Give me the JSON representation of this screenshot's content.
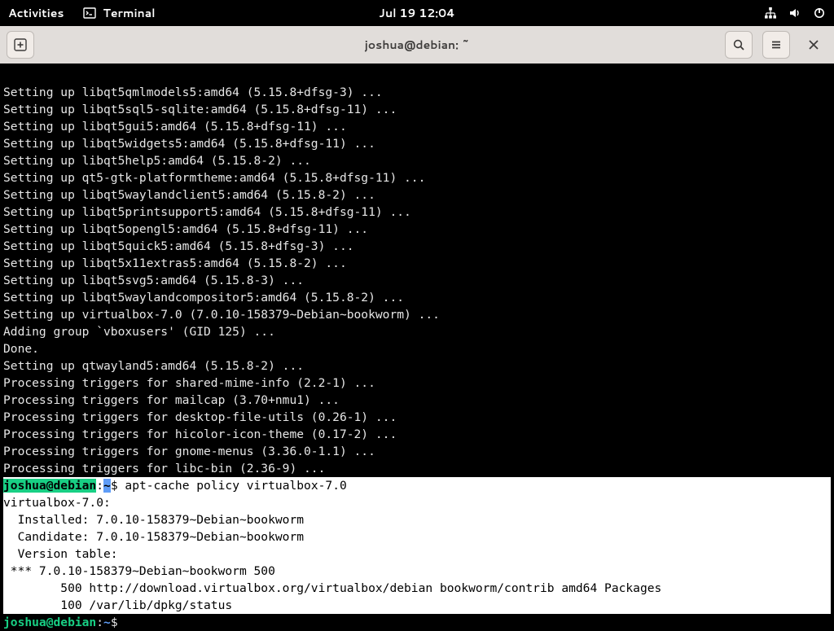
{
  "top_panel": {
    "activities": "Activities",
    "app_label": "Terminal",
    "datetime": "Jul 19  12:04"
  },
  "titlebar": {
    "title": "joshua@debian: ~"
  },
  "terminal": {
    "setup_lines": [
      "Setting up libqt5qmlmodels5:amd64 (5.15.8+dfsg-3) ...",
      "Setting up libqt5sql5-sqlite:amd64 (5.15.8+dfsg-11) ...",
      "Setting up libqt5gui5:amd64 (5.15.8+dfsg-11) ...",
      "Setting up libqt5widgets5:amd64 (5.15.8+dfsg-11) ...",
      "Setting up libqt5help5:amd64 (5.15.8-2) ...",
      "Setting up qt5-gtk-platformtheme:amd64 (5.15.8+dfsg-11) ...",
      "Setting up libqt5waylandclient5:amd64 (5.15.8-2) ...",
      "Setting up libqt5printsupport5:amd64 (5.15.8+dfsg-11) ...",
      "Setting up libqt5opengl5:amd64 (5.15.8+dfsg-11) ...",
      "Setting up libqt5quick5:amd64 (5.15.8+dfsg-3) ...",
      "Setting up libqt5x11extras5:amd64 (5.15.8-2) ...",
      "Setting up libqt5svg5:amd64 (5.15.8-3) ...",
      "Setting up libqt5waylandcompositor5:amd64 (5.15.8-2) ...",
      "Setting up virtualbox-7.0 (7.0.10-158379~Debian~bookworm) ...",
      "Adding group `vboxusers' (GID 125) ...",
      "Done.",
      "Setting up qtwayland5:amd64 (5.15.8-2) ...",
      "Processing triggers for shared-mime-info (2.2-1) ...",
      "Processing triggers for mailcap (3.70+nmu1) ...",
      "Processing triggers for desktop-file-utils (0.26-1) ...",
      "Processing triggers for hicolor-icon-theme (0.17-2) ...",
      "Processing triggers for gnome-menus (3.36.0-1.1) ...",
      "Processing triggers for libc-bin (2.36-9) ..."
    ],
    "prompt1": {
      "user": "joshua@debian",
      "colon": ":",
      "tilde": "~",
      "dollar": "$ ",
      "command": "apt-cache policy virtualbox-7.0"
    },
    "policy_output": [
      "virtualbox-7.0:",
      "  Installed: 7.0.10-158379~Debian~bookworm",
      "  Candidate: 7.0.10-158379~Debian~bookworm",
      "  Version table:",
      " *** 7.0.10-158379~Debian~bookworm 500",
      "        500 http://download.virtualbox.org/virtualbox/debian bookworm/contrib amd64 Packages",
      "        100 /var/lib/dpkg/status"
    ],
    "prompt2": {
      "user": "joshua@debian",
      "colon": ":",
      "tilde": "~",
      "dollar": "$ "
    }
  }
}
